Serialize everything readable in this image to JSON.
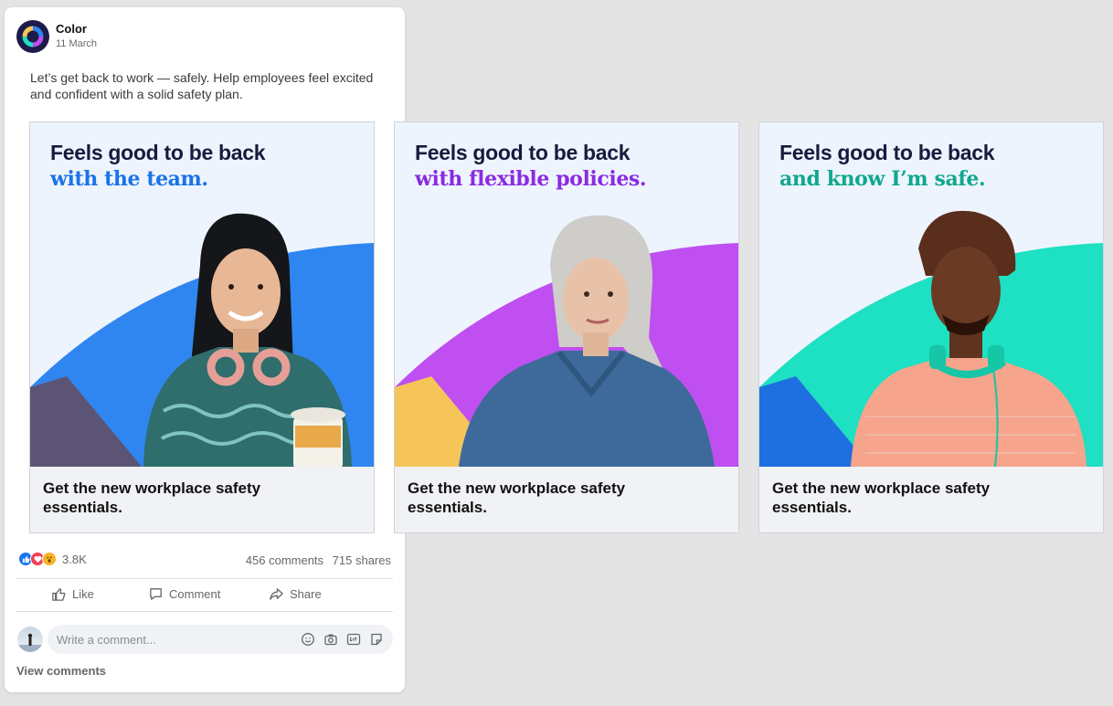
{
  "post": {
    "page_name": "Color",
    "date": "11 March",
    "caption": "Let’s get back to work — safely. Help employees feel excited and confident with a solid safety plan.",
    "reactions_count": "3.8K",
    "comments": "456 comments",
    "shares": "715 shares",
    "actions": {
      "like": "Like",
      "comment": "Comment",
      "share": "Share"
    },
    "comment_placeholder": "Write a comment...",
    "view_comments": "View comments"
  },
  "cards": [
    {
      "headline1": "Feels good to be back",
      "headline2": "with the team.",
      "cta": "Get the new workplace safety essentials.",
      "accent": "#1a73e8",
      "arc_color": "#2f86f0",
      "corner_color": "#5c5475"
    },
    {
      "headline1": "Feels good to be back",
      "headline2": "with flexible policies.",
      "cta": "Get the new workplace safety essentials.",
      "accent": "#8a2be2",
      "arc_color": "#bf4ff0",
      "corner_color": "#f6c55a"
    },
    {
      "headline1": "Feels good to be back",
      "headline2": "and know I’m safe.",
      "cta": "Get the new workplace safety essentials.",
      "accent": "#10a88f",
      "arc_color": "#1ee0c2",
      "corner_color": "#1e6fe0"
    }
  ],
  "icons": {
    "reactions": [
      "like-reaction-icon",
      "love-reaction-icon",
      "wow-reaction-icon"
    ],
    "comment_tools": [
      "emoji-icon",
      "camera-icon",
      "gif-icon",
      "sticker-icon"
    ]
  }
}
